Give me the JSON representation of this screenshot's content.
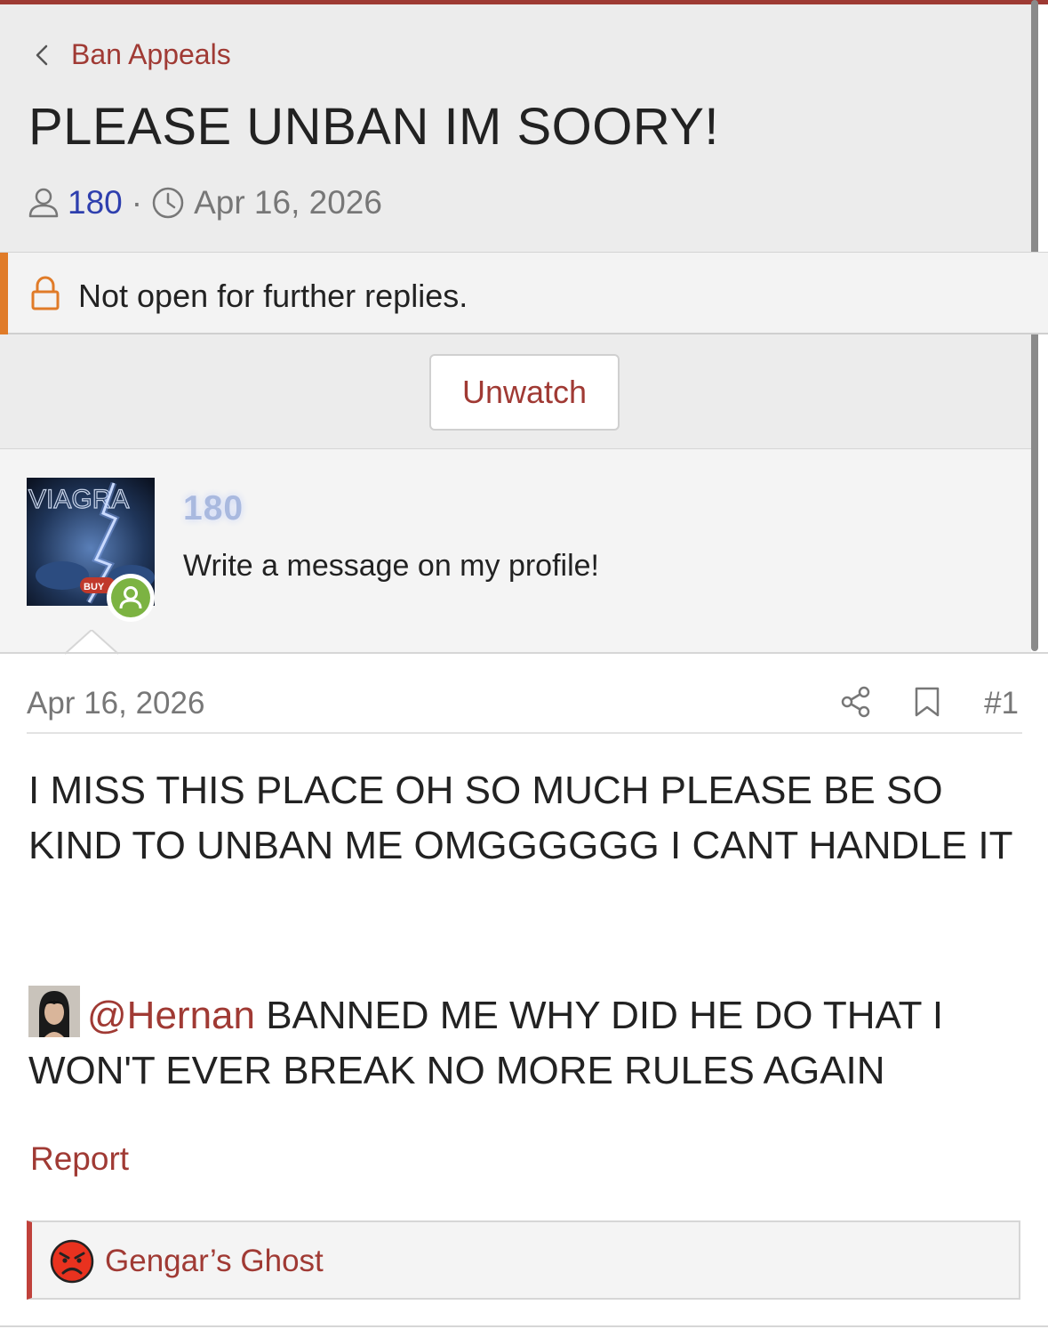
{
  "breadcrumb": {
    "label": "Ban Appeals"
  },
  "thread": {
    "title": "PLEASE UNBAN IM SOORY!",
    "author": "180",
    "separator": "·",
    "date": "Apr 16, 2026"
  },
  "notice": {
    "text": "Not open for further replies."
  },
  "actions": {
    "unwatch_label": "Unwatch"
  },
  "user": {
    "name": "180",
    "title": "Write a message on my profile!",
    "avatar_text": "VIAGRA",
    "avatar_badge": "BUY"
  },
  "post": {
    "date": "Apr 16, 2026",
    "number": "#1",
    "body_line1": "I MISS THIS PLACE OH SO MUCH PLEASE BE SO KIND TO UNBAN ME OMGGGGGG I CANT HANDLE IT",
    "mention": "@Hernan",
    "body_line2": " BANNED ME WHY DID HE DO THAT I WON'T EVER BREAK NO MORE RULES AGAIN",
    "report_label": "Report"
  },
  "reactions": {
    "icon": "angry-face-icon",
    "users": "Gengar’s Ghost"
  },
  "colors": {
    "accent": "#a03a34",
    "lock_notice": "#e07b28",
    "online": "#7cb342",
    "username_link": "#2e3fae"
  }
}
